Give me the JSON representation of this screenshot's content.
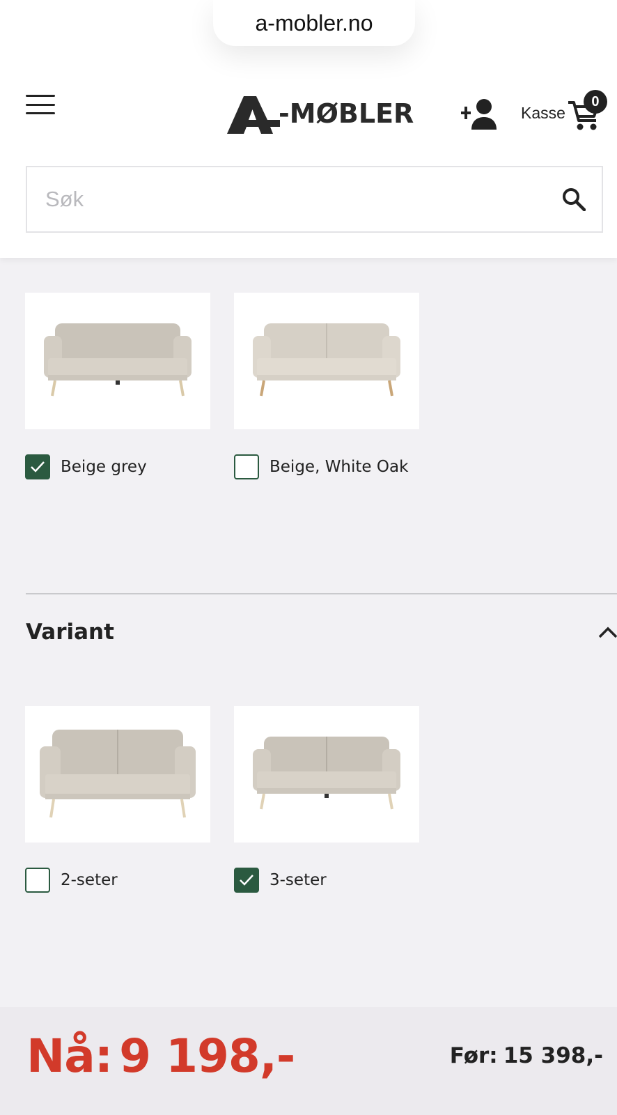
{
  "browser": {
    "url": "a-mobler.no"
  },
  "header": {
    "logo_text": "-MØBLER",
    "kasse_label": "Kasse",
    "cart_count": "0",
    "search_placeholder": "Søk"
  },
  "color_options": [
    {
      "label": "Beige grey",
      "checked": true
    },
    {
      "label": "Beige, White Oak",
      "checked": false
    }
  ],
  "variant": {
    "title": "Variant",
    "options": [
      {
        "label": "2-seter",
        "checked": false
      },
      {
        "label": "3-seter",
        "checked": true
      }
    ]
  },
  "price": {
    "now_label": "Nå:",
    "now_value": "9 198,-",
    "before_label": "Før:",
    "before_value": "15 398,-"
  },
  "colors": {
    "accent_green": "#2b5a40",
    "price_red": "#d23a2a"
  }
}
